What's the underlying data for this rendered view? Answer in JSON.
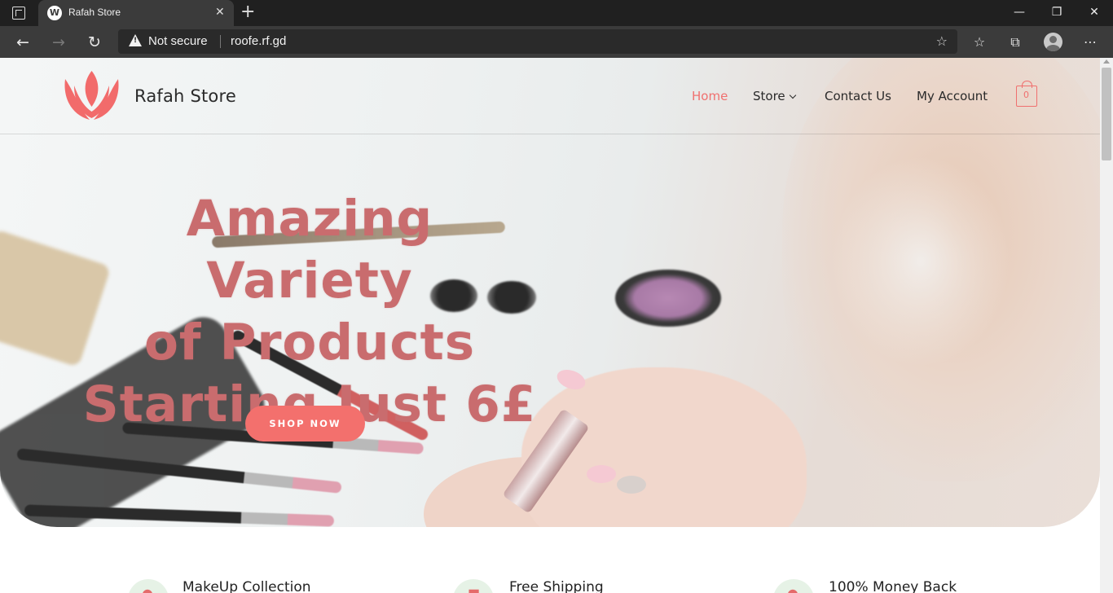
{
  "browser": {
    "tab_title": "Rafah Store",
    "tab_favicon": "W",
    "security_label": "Not secure",
    "url": "roofe.rf.gd",
    "win_minimize": "—",
    "win_restore": "❐",
    "win_close": "✕",
    "new_tab": "+",
    "tab_close": "✕"
  },
  "site": {
    "brand_name": "Rafah Store",
    "brand_color": "#f0706f",
    "nav": {
      "home": "Home",
      "store": "Store",
      "contact": "Contact Us",
      "account": "My Account"
    },
    "cart_count": "0"
  },
  "hero": {
    "headline_lines": [
      "Amazing Variety",
      "of Products",
      "Starting Just 6£"
    ],
    "cta_label": "SHOP NOW"
  },
  "features": [
    {
      "title": "MakeUp Collection",
      "icon": "makeup-icon"
    },
    {
      "title": "Free Shipping",
      "icon": "shipping-icon"
    },
    {
      "title": "100% Money Back",
      "icon": "money-back-icon"
    }
  ]
}
